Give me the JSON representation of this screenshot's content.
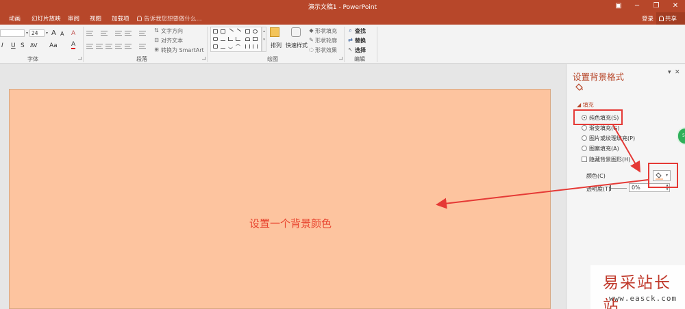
{
  "window": {
    "title": "演示文稿1 - PowerPoint",
    "controls": {
      "ribbon_display": "▣",
      "minimize": "─",
      "restore": "❐",
      "close": "✕"
    }
  },
  "tabs": [
    {
      "label": "动画"
    },
    {
      "label": "幻灯片放映"
    },
    {
      "label": "审阅"
    },
    {
      "label": "视图"
    },
    {
      "label": "加载项"
    }
  ],
  "tell_me": "告诉我您想要做什么...",
  "account": {
    "login": "登录",
    "share": "共享"
  },
  "ribbon": {
    "font": {
      "label": "字体",
      "size": "24",
      "grow": "A",
      "shrink": "A",
      "clear": "A",
      "italic": "I",
      "underline": "U",
      "strike": "S",
      "char_spacing": "AV",
      "change_case": "Aa",
      "font_color": "A"
    },
    "paragraph": {
      "label": "段落",
      "text_direction": "文字方向",
      "align_text": "对齐文本",
      "smartart": "转换为 SmartArt"
    },
    "drawing": {
      "label": "绘图",
      "arrange": "排列",
      "quick_styles": "快速样式",
      "shape_fill": "形状填充",
      "shape_outline": "形状轮廓",
      "shape_effects": "形状效果"
    },
    "editing": {
      "label": "编辑",
      "find": "查找",
      "replace": "替换",
      "select": "选择"
    }
  },
  "slide": {
    "text": "设置一个背景颜色",
    "background_color": "#fdc49f"
  },
  "format_pane": {
    "title": "设置背景格式",
    "section": "填充",
    "options": [
      {
        "label": "纯色填充(S)",
        "selected": true
      },
      {
        "label": "渐变填充(G)",
        "selected": false
      },
      {
        "label": "图片或纹理填充(P)",
        "selected": false
      },
      {
        "label": "图案填充(A)",
        "selected": false
      }
    ],
    "hide_bg_graphics": "隐藏背景图形(H)",
    "color_label": "颜色(C)",
    "transparency_label": "透明度(T)",
    "transparency_value": "0%",
    "floating_button": "58"
  },
  "watermark": {
    "name": "易采站长站",
    "url": "www.easck.com"
  },
  "colors": {
    "accent": "#b7472a",
    "annotation": "#e53935"
  }
}
